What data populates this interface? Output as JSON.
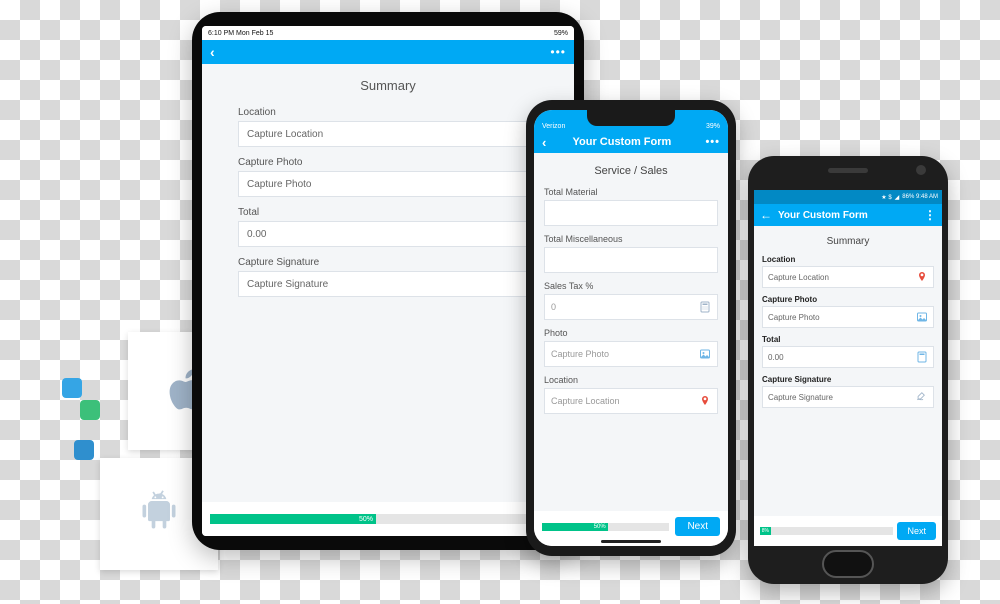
{
  "ipad": {
    "status_left": "6:10 PM   Mon Feb 15",
    "status_right": "59%",
    "section_title": "Summary",
    "fields": {
      "location_label": "Location",
      "location_value": "Capture Location",
      "photo_label": "Capture Photo",
      "photo_value": "Capture Photo",
      "total_label": "Total",
      "total_value": "0.00",
      "signature_label": "Capture Signature",
      "signature_value": "Capture Signature"
    },
    "progress_text": "50%"
  },
  "iphone": {
    "status_left": "Verizon",
    "status_right": "39%",
    "header_title": "Your Custom Form",
    "section_title": "Service / Sales",
    "fields": {
      "total_material_label": "Total Material",
      "total_misc_label": "Total Miscellaneous",
      "sales_tax_label": "Sales Tax %",
      "sales_tax_placeholder": "0",
      "photo_label": "Photo",
      "photo_placeholder": "Capture Photo",
      "location_label": "Location",
      "location_placeholder": "Capture Location"
    },
    "progress_text": "50%",
    "next_label": "Next"
  },
  "android": {
    "status_right": "86% 9:48 AM",
    "header_title": "Your Custom Form",
    "section_title": "Summary",
    "fields": {
      "location_label": "Location",
      "location_value": "Capture Location",
      "photo_label": "Capture Photo",
      "photo_value": "Capture Photo",
      "total_label": "Total",
      "total_value": "0.00",
      "signature_label": "Capture Signature",
      "signature_value": "Capture Signature"
    },
    "progress_text": "8%",
    "next_label": "Next"
  }
}
